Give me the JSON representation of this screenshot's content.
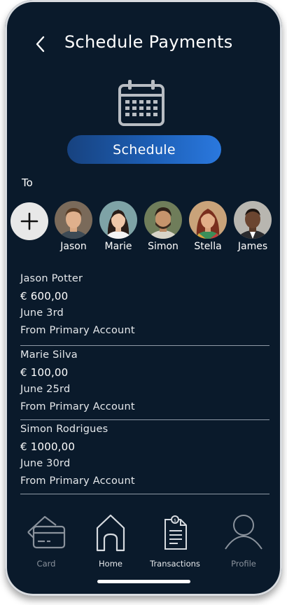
{
  "header": {
    "title": "Schedule Payments",
    "back_icon": "chevron-left-icon"
  },
  "calendar_icon": "calendar-icon",
  "schedule_button": "Schedule",
  "to_label": "To",
  "add_icon": "plus-icon",
  "contacts": [
    {
      "name": "Jason"
    },
    {
      "name": "Marie"
    },
    {
      "name": "Simon"
    },
    {
      "name": "Stella"
    },
    {
      "name": "James"
    }
  ],
  "payments": [
    {
      "name": "Jason Potter",
      "amount": "€ 600,00",
      "date": "June 3rd",
      "account": "From Primary Account"
    },
    {
      "name": "Marie Silva",
      "amount": "€ 100,00",
      "date": "June 25rd",
      "account": "From Primary Account"
    },
    {
      "name": "Simon Rodrigues",
      "amount": "€ 1000,00",
      "date": "June 30rd",
      "account": "From Primary Account"
    }
  ],
  "nav": [
    {
      "label": "Card",
      "icon": "card-icon",
      "active": false
    },
    {
      "label": "Home",
      "icon": "home-icon",
      "active": true
    },
    {
      "label": "Transactions",
      "icon": "receipt-icon",
      "active": true
    },
    {
      "label": "Profile",
      "icon": "profile-icon",
      "active": false
    }
  ],
  "colors": {
    "background": "#0a1a2b",
    "accent": "#1d5fb6",
    "inactive": "#8a929c"
  }
}
